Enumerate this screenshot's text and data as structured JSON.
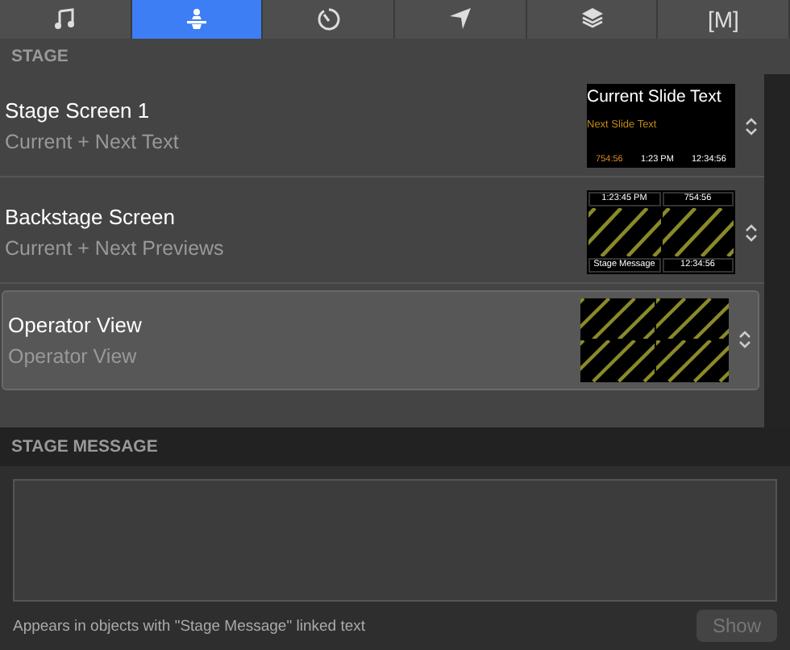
{
  "tabs": [
    {
      "kind": "music",
      "selected": false
    },
    {
      "kind": "stage",
      "selected": true
    },
    {
      "kind": "timer",
      "selected": false
    },
    {
      "kind": "send",
      "selected": false
    },
    {
      "kind": "layers",
      "selected": false
    },
    {
      "kind": "macro",
      "label": "[M]",
      "selected": false
    }
  ],
  "stage": {
    "title": "STAGE",
    "screens": [
      {
        "name": "Stage Screen 1",
        "layout": "Current + Next Text",
        "selected": false,
        "thumbnail": {
          "kind": "slide-text",
          "current": "Current Slide Text",
          "next": "Next Slide Text",
          "timers": [
            "754:56",
            "1:23 PM",
            "12:34:56"
          ]
        }
      },
      {
        "name": "Backstage Screen",
        "layout": "Current + Next Previews",
        "selected": false,
        "thumbnail": {
          "kind": "previews",
          "top": [
            "1:23:45 PM",
            "754:56"
          ],
          "bottom": [
            "Stage Message",
            "12:34:56"
          ]
        }
      },
      {
        "name": "Operator View",
        "layout": "Operator View",
        "selected": true,
        "thumbnail": {
          "kind": "operator"
        }
      }
    ]
  },
  "message": {
    "title": "STAGE MESSAGE",
    "hint": "Appears in objects with \"Stage Message\" linked text",
    "button": {
      "label": "Show",
      "disabled": true
    }
  }
}
